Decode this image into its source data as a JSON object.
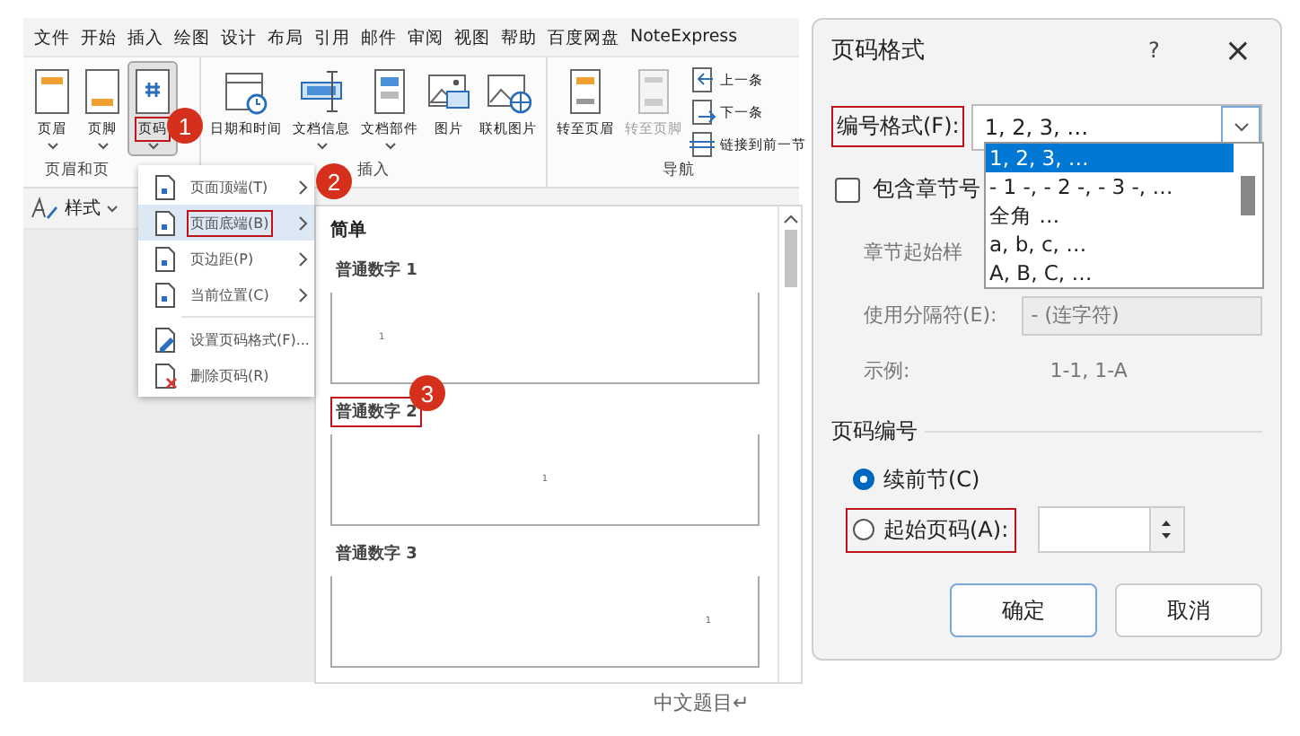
{
  "ribbon": {
    "tabs": [
      "文件",
      "开始",
      "插入",
      "绘图",
      "设计",
      "布局",
      "引用",
      "邮件",
      "审阅",
      "视图",
      "帮助",
      "百度网盘",
      "NoteExpress"
    ],
    "groups": [
      {
        "label": "页眉和页",
        "buttons": [
          {
            "label": "页眉",
            "kind": "header",
            "dropdown": true,
            "selected": false,
            "highlighted": false,
            "disabled": false
          },
          {
            "label": "页脚",
            "kind": "footer",
            "dropdown": true,
            "selected": false,
            "highlighted": false,
            "disabled": false
          },
          {
            "label": "页码",
            "kind": "page-number",
            "dropdown": true,
            "selected": true,
            "highlighted": true,
            "disabled": false,
            "badge": "1"
          }
        ]
      },
      {
        "label": "插入",
        "buttons": [
          {
            "label": "日期和时间",
            "kind": "datetime",
            "dropdown": false,
            "selected": false,
            "highlighted": false,
            "disabled": false
          },
          {
            "label": "文档信息",
            "kind": "doc-info",
            "dropdown": true,
            "selected": false,
            "highlighted": false,
            "disabled": false
          },
          {
            "label": "文档部件",
            "kind": "quick-parts",
            "dropdown": true,
            "selected": false,
            "highlighted": false,
            "disabled": false
          },
          {
            "label": "图片",
            "kind": "picture",
            "dropdown": false,
            "selected": false,
            "highlighted": false,
            "disabled": false
          },
          {
            "label": "联机图片",
            "kind": "online-picture",
            "dropdown": false,
            "selected": false,
            "highlighted": false,
            "disabled": false
          }
        ]
      },
      {
        "label": "导航",
        "buttons": [
          {
            "label": "转至页眉",
            "kind": "goto-header",
            "dropdown": false,
            "selected": false,
            "highlighted": false,
            "disabled": false
          },
          {
            "label": "转至页脚",
            "kind": "goto-footer",
            "dropdown": false,
            "selected": false,
            "highlighted": false,
            "disabled": true
          }
        ],
        "small_buttons": [
          {
            "label": "上一条",
            "kind": "prev"
          },
          {
            "label": "下一条",
            "kind": "next"
          },
          {
            "label": "链接到前一节",
            "kind": "link"
          }
        ]
      }
    ]
  },
  "styles_bar": {
    "label": "样式"
  },
  "page_number_menu": {
    "items": [
      {
        "label": "页面顶端(T)",
        "kind": "page",
        "submenu": true,
        "selected": false,
        "highlighted": false
      },
      {
        "label": "页面底端(B)",
        "kind": "page",
        "submenu": true,
        "selected": true,
        "highlighted": true,
        "badge": "2"
      },
      {
        "label": "页边距(P)",
        "kind": "page",
        "submenu": true,
        "selected": false,
        "highlighted": false
      },
      {
        "label": "当前位置(C)",
        "kind": "page",
        "submenu": true,
        "selected": false,
        "highlighted": false
      },
      {
        "label": "设置页码格式(F)...",
        "kind": "format",
        "submenu": false,
        "selected": false,
        "highlighted": false
      },
      {
        "label": "删除页码(R)",
        "kind": "delete",
        "submenu": false,
        "selected": false,
        "highlighted": false
      }
    ]
  },
  "gallery": {
    "section": "简单",
    "items": [
      {
        "label": "普通数字 1",
        "kind": "left",
        "page_number": "1",
        "highlighted": false
      },
      {
        "label": "普通数字 2",
        "kind": "center",
        "page_number": "1",
        "highlighted": true,
        "badge": "3"
      },
      {
        "label": "普通数字 3",
        "kind": "right",
        "page_number": "1",
        "highlighted": false
      }
    ]
  },
  "document": {
    "title": "中文题目↵"
  },
  "dialog": {
    "title": "页码格式",
    "help": "?",
    "close": "×",
    "number_format": {
      "label": "编号格式(F):",
      "value": "1, 2, 3, …",
      "highlighted": true,
      "options": [
        {
          "label": "1, 2, 3, …",
          "selected": true
        },
        {
          "label": "- 1 -, - 2 -, - 3 -, …",
          "selected": false
        },
        {
          "label": "全角 …",
          "selected": false
        },
        {
          "label": "a, b, c, …",
          "selected": false
        },
        {
          "label": "A, B, C, …",
          "selected": false
        }
      ]
    },
    "include_chapter": {
      "label": "包含章节号",
      "checked": false
    },
    "chapter_style": {
      "label": "章节起始样"
    },
    "separator": {
      "label": "使用分隔符(E):",
      "value": "- (连字符)"
    },
    "example": {
      "label": "示例:",
      "value": "1-1, 1-A"
    },
    "numbering": {
      "title": "页码编号",
      "options": [
        {
          "label": "续前节(C)",
          "selected": true,
          "highlighted": false
        },
        {
          "label": "起始页码(A):",
          "selected": false,
          "highlighted": true
        }
      ]
    },
    "buttons": [
      {
        "label": "确定",
        "default": true
      },
      {
        "label": "取消",
        "default": false
      }
    ]
  }
}
